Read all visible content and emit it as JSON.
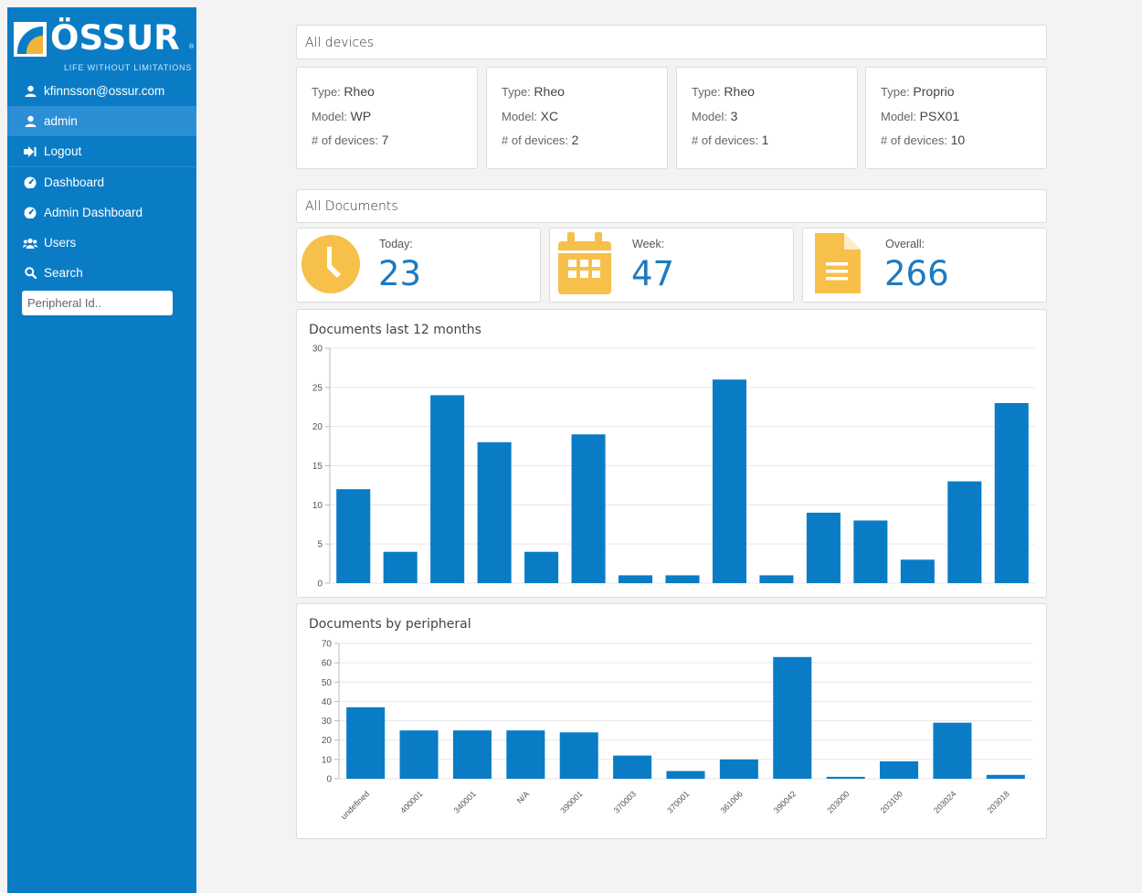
{
  "brand": {
    "name": "ÖSSUR",
    "tagline": "LIFE WITHOUT LIMITATIONS",
    "reg": "®"
  },
  "colors": {
    "sidebar": "#0a7cc6",
    "accent": "#1e7ac0",
    "bar": "#0a7cc6",
    "icon": "#f7c04a"
  },
  "sidebar": {
    "user_email": "kfinnsson@ossur.com",
    "items": [
      {
        "label": "admin",
        "icon": "user-icon"
      },
      {
        "label": "Logout",
        "icon": "logout-icon"
      },
      {
        "label": "Dashboard",
        "icon": "dashboard-icon"
      },
      {
        "label": "Admin Dashboard",
        "icon": "dashboard-icon"
      },
      {
        "label": "Users",
        "icon": "users-icon"
      },
      {
        "label": "Search",
        "icon": "search-icon"
      }
    ],
    "search_placeholder": "Peripheral Id.."
  },
  "devices": {
    "title": "All devices",
    "type_label": "Type:",
    "model_label": "Model:",
    "count_label": "# of devices:",
    "cards": [
      {
        "type": "Rheo",
        "model": "WP",
        "count": "7"
      },
      {
        "type": "Rheo",
        "model": "XC",
        "count": "2"
      },
      {
        "type": "Rheo",
        "model": "3",
        "count": "1"
      },
      {
        "type": "Proprio",
        "model": "PSX01",
        "count": "10"
      }
    ]
  },
  "documents": {
    "title": "All Documents",
    "stats": [
      {
        "label": "Today:",
        "value": "23",
        "icon": "clock-icon"
      },
      {
        "label": "Week:",
        "value": "47",
        "icon": "calendar-icon"
      },
      {
        "label": "Overall:",
        "value": "266",
        "icon": "file-icon"
      }
    ]
  },
  "chart_data": [
    {
      "type": "bar",
      "title": "Documents last 12 months",
      "categories": [
        "",
        "",
        "",
        "",
        "",
        "",
        "",
        "",
        "",
        "",
        "",
        "",
        "",
        "",
        ""
      ],
      "values": [
        12,
        4,
        24,
        18,
        4,
        19,
        1,
        1,
        26,
        1,
        9,
        8,
        3,
        13,
        23
      ],
      "ylim": [
        0,
        30
      ],
      "yticks": [
        0,
        5,
        10,
        15,
        20,
        25,
        30
      ],
      "grid": true
    },
    {
      "type": "bar",
      "title": "Documents by peripheral",
      "categories": [
        "undefined",
        "400001",
        "340001",
        "N/A",
        "390001",
        "370003",
        "370001",
        "361006",
        "390042",
        "203000",
        "203100",
        "203024",
        "203018"
      ],
      "values": [
        37,
        25,
        25,
        25,
        24,
        12,
        4,
        10,
        63,
        1,
        9,
        29,
        2
      ],
      "ylim": [
        0,
        70
      ],
      "yticks": [
        0,
        10,
        20,
        30,
        40,
        50,
        60,
        70
      ],
      "grid": true
    }
  ]
}
